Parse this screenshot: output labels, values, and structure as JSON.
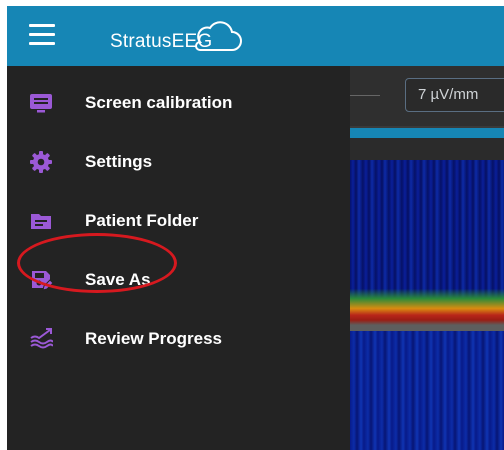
{
  "header": {
    "brand_name": "StratusEEG",
    "menu_icon": "hamburger-menu-icon",
    "background_color": "#1686b5"
  },
  "drawer": {
    "items": [
      {
        "label": "Screen calibration",
        "icon": "monitor-icon"
      },
      {
        "label": "Settings",
        "icon": "gear-icon"
      },
      {
        "label": "Patient Folder",
        "icon": "folder-icon"
      },
      {
        "label": "Save As",
        "icon": "save-edit-icon",
        "highlighted": true
      },
      {
        "label": "Review Progress",
        "icon": "waves-progress-icon"
      }
    ],
    "icon_color": "#9b59d6",
    "highlight_color": "#d6191f"
  },
  "main": {
    "scale_value": "7 µV/mm"
  }
}
